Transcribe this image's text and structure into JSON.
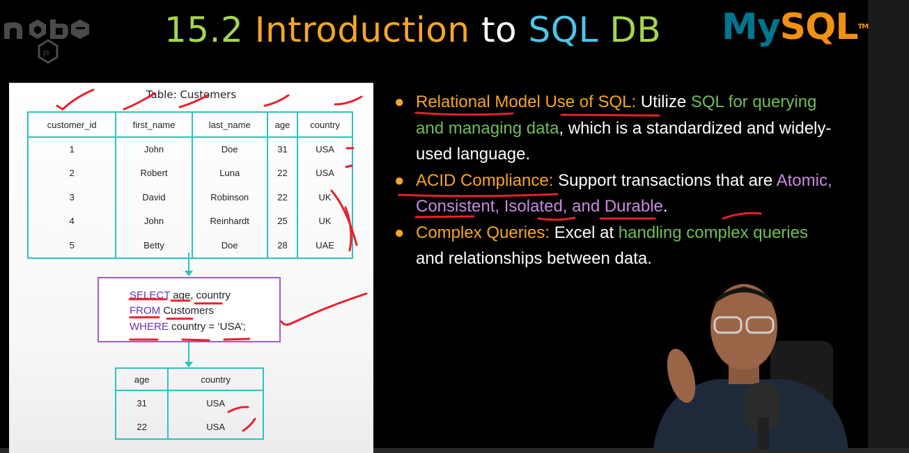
{
  "header": {
    "title_number": "15.2",
    "title_intro": "Introduction",
    "title_to": "to",
    "title_sql": "SQL",
    "title_db": "DB",
    "brand_left_icon": "nodejs-logo",
    "brand_right_my": "My",
    "brand_right_sql": "SQL",
    "brand_right_tm": "TM"
  },
  "diagram": {
    "table_title": "Table: Customers",
    "columns": [
      "customer_id",
      "first_name",
      "last_name",
      "age",
      "country"
    ],
    "rows": [
      [
        "1",
        "John",
        "Doe",
        "31",
        "USA"
      ],
      [
        "2",
        "Robert",
        "Luna",
        "22",
        "USA"
      ],
      [
        "3",
        "David",
        "Robinson",
        "22",
        "UK"
      ],
      [
        "4",
        "John",
        "Reinhardt",
        "25",
        "UK"
      ],
      [
        "5",
        "Betty",
        "Doe",
        "28",
        "UAE"
      ]
    ],
    "query": {
      "select_kw": "SELECT",
      "select_rest": " age, country",
      "from_kw": "FROM",
      "from_rest": " Customers",
      "where_kw": "WHERE",
      "where_rest": " country = ‘USA’;"
    },
    "result_columns": [
      "age",
      "country"
    ],
    "result_rows": [
      [
        "31",
        "USA"
      ],
      [
        "22",
        "USA"
      ]
    ]
  },
  "bullets": [
    {
      "heading": "Relational Model Use of SQL:",
      "t1": " Utilize ",
      "g1": "SQL for querying and managing data",
      "t2": ", which is a standardized and widely-used language."
    },
    {
      "heading": "ACID Compliance:",
      "t1": " Support transactions that are ",
      "p1": "Atomic, Consistent, Isolated, and Durable",
      "t2": "."
    },
    {
      "heading": "Complex Queries:",
      "t1": " Excel at ",
      "g1": "handling complex queries",
      "t2": " and relationships between data."
    }
  ],
  "colors": {
    "accent_orange": "#f5a623",
    "accent_green": "#6fbf55",
    "accent_pink": "#c88be0",
    "table_border": "#2cc2c0",
    "query_border": "#9c5ccc",
    "annotation_red": "#e8202a"
  }
}
